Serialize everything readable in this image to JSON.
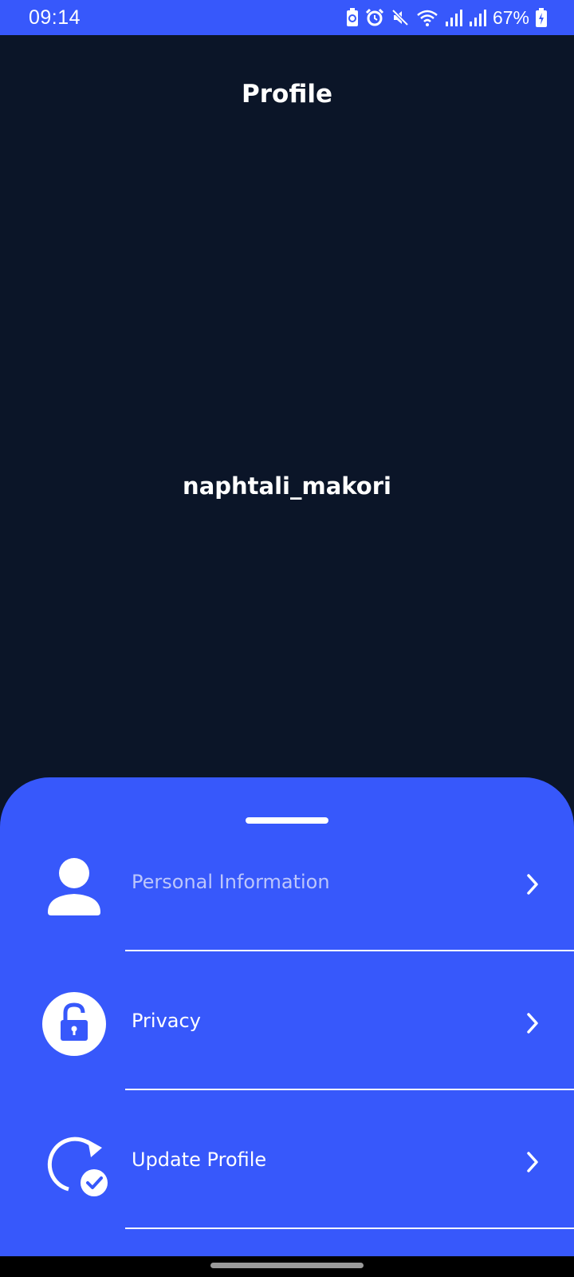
{
  "status_bar": {
    "time": "09:14",
    "battery_percent": "67%",
    "icons": [
      "battery-saver-icon",
      "alarm-icon",
      "mute-icon",
      "wifi-icon",
      "signal-icon",
      "signal-icon",
      "battery-icon"
    ]
  },
  "header": {
    "title": "Profile"
  },
  "profile": {
    "username": "naphtali_makori"
  },
  "menu": {
    "items": [
      {
        "label": "Personal Information",
        "icon": "person-icon"
      },
      {
        "label": "Privacy",
        "icon": "unlock-icon"
      },
      {
        "label": "Update Profile",
        "icon": "refresh-check-icon"
      }
    ]
  },
  "colors": {
    "background": "#0b1528",
    "accent": "#3758fb",
    "text": "#ffffff",
    "muted_text": "#bcc6fb"
  }
}
